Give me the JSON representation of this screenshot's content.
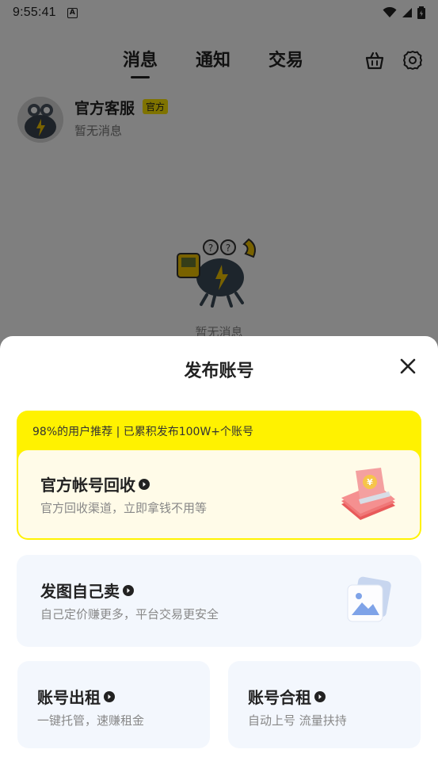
{
  "status_bar": {
    "time": "9:55:41",
    "badge": "A"
  },
  "header": {
    "tabs": [
      {
        "label": "消息",
        "active": true
      },
      {
        "label": "通知",
        "active": false
      },
      {
        "label": "交易",
        "active": false
      }
    ],
    "icons": [
      "basket-icon",
      "gear-icon"
    ]
  },
  "conversation": {
    "name": "官方客服",
    "badge": "官方",
    "preview": "暂无消息"
  },
  "empty_state": {
    "text": "暂无消息"
  },
  "sheet": {
    "title": "发布账号",
    "recommend_banner": "98%的用户推荐 | 已累积发布100W+个账号",
    "official": {
      "title": "官方帐号回收",
      "subtitle": "官方回收渠道，立即拿钱不用等"
    },
    "self_sell": {
      "title": "发图自己卖",
      "subtitle": "自己定价赚更多，平台交易更安全"
    },
    "rent": {
      "title": "账号出租",
      "subtitle": "一键托管，速赚租金"
    },
    "co_rent": {
      "title": "账号合租",
      "subtitle": "自动上号 流量扶持"
    }
  },
  "colors": {
    "accent": "#fff200",
    "card_bg": "#f3f7fd",
    "rec_inner_bg": "#fffbe8"
  }
}
